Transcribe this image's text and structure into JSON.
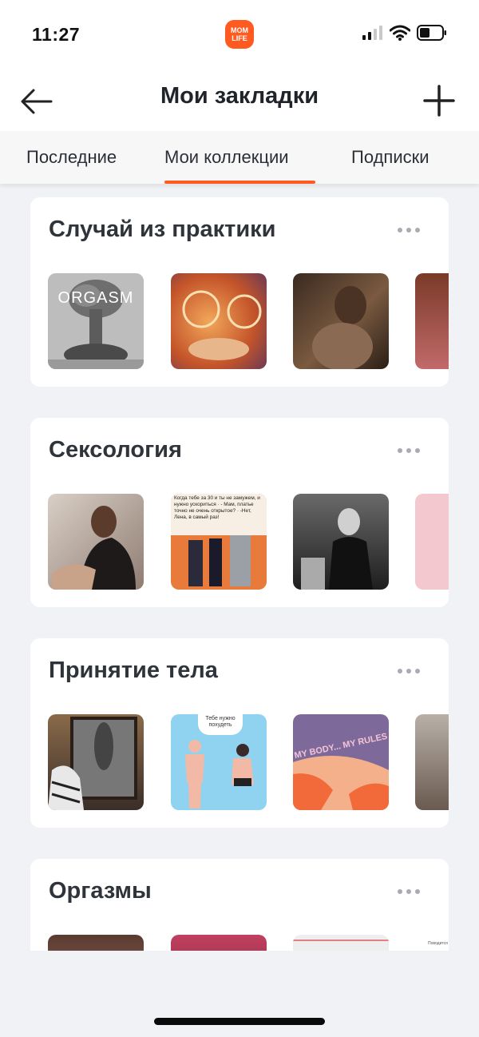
{
  "status_bar": {
    "time": "11:27",
    "app_logo_lines": [
      "MOM",
      "LIFE"
    ]
  },
  "header": {
    "title": "Мои закладки",
    "back_icon": "arrow-left-icon",
    "add_icon": "plus-icon"
  },
  "tabs": [
    {
      "label": "Последние",
      "active": false
    },
    {
      "label": "Мои коллекции",
      "active": true
    },
    {
      "label": "Подписки",
      "active": false
    }
  ],
  "colors": {
    "accent": "#ff5a1f",
    "background": "#f1f2f5",
    "card": "#ffffff",
    "text": "#2b2f36"
  },
  "collections": [
    {
      "title": "Случай из практики",
      "thumbnails": [
        {
          "label": "ORGASM"
        },
        {},
        {},
        {}
      ]
    },
    {
      "title": "Сексология",
      "thumbnails": [
        {},
        {
          "label": "Когда тебе за 30 и ты не замужем, и нужно ускориться · - Мам, платье точно не очень открытое? · -Нет, Лена, в самый раз!"
        },
        {},
        {}
      ]
    },
    {
      "title": "Принятие тела",
      "thumbnails": [
        {},
        {
          "label": "Тебе нужно похудеть"
        },
        {
          "label": "MY BODY... MY RULES"
        },
        {}
      ]
    },
    {
      "title": "Оргазмы",
      "thumbnails": [
        {},
        {},
        {},
        {
          "label": "Поводится"
        }
      ]
    }
  ]
}
